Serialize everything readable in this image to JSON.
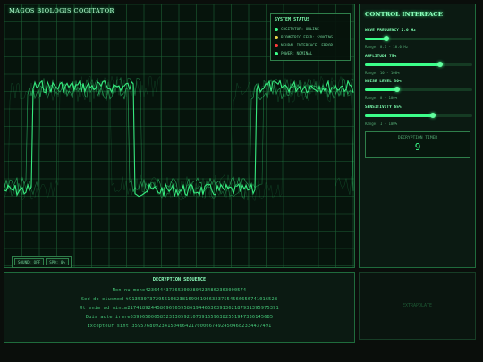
{
  "scope": {
    "title": "MAGOS BIOLOGIS COGITATOR",
    "status": {
      "heading": "SYSTEM STATUS",
      "items": [
        {
          "label": "COGITATOR: ONLINE",
          "color": "#3cff8a"
        },
        {
          "label": "BIOMETRIC FEED: SYNCING",
          "color": "#e6d34a"
        },
        {
          "label": "NEURAL INTERFACE: ERROR",
          "color": "#ff3b3b"
        },
        {
          "label": "POWER: NOMINAL",
          "color": "#3cff8a"
        }
      ]
    },
    "buttons": [
      "SOUND: OFF",
      "SPD: 0%"
    ]
  },
  "controls": {
    "title": "CONTROL INTERFACE",
    "params": [
      {
        "label": "WAVE FREQUENCY 2.0 Hz",
        "range": "Range: 0.1 - 10.0 Hz",
        "level": 0.2
      },
      {
        "label": "AMPLITUDE 75%",
        "range": "Range: 10 - 100%",
        "level": 0.7
      },
      {
        "label": "NOISE LEVEL 30%",
        "range": "Range: 0 - 100%",
        "level": 0.3
      },
      {
        "label": "SENSITIVITY 65%",
        "range": "Range: 1 - 100%",
        "level": 0.63
      }
    ],
    "timer_label": "DECRYPTION TIMER",
    "timer_value": "9"
  },
  "decrypt": {
    "heading": "DECRYPTION SEQUENCE",
    "lines": [
      "Non nu mene4236444373653002804234862363000574",
      "Sed do eiusmod t9135307372956103238169961966323755456665674101652B",
      "Ut enim ad minim217418924458696765958619446536391362187931395975391",
      "Duis aute irure6399650005852313059210739165963825519473361456B5",
      "Excepteur sint 35957680923415046642170006674924504682334437491"
    ]
  },
  "extra": {
    "label": "EXTRAPOLATE"
  },
  "colors": {
    "accent": "#3cff8a",
    "grid": "#1f6b3c"
  }
}
